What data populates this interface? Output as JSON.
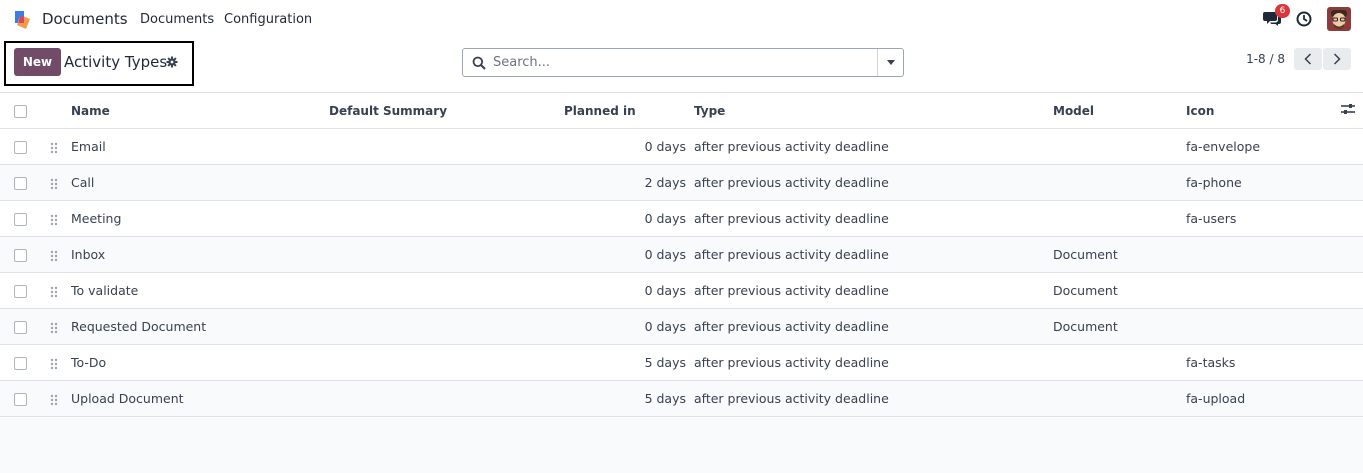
{
  "navbar": {
    "app_name": "Documents",
    "menus": [
      "Documents",
      "Configuration"
    ],
    "messages_badge": "6",
    "brand_colors": {
      "primary": "#714b67",
      "badge": "#d9363e"
    }
  },
  "control_panel": {
    "new_label": "New",
    "title": "Activity Types",
    "search_placeholder": "Search...",
    "pager_value": "1-8 / 8"
  },
  "table": {
    "headers": {
      "name": "Name",
      "summary": "Default Summary",
      "planned": "Planned in",
      "type": "Type",
      "model": "Model",
      "icon": "Icon"
    },
    "rows": [
      {
        "name": "Email",
        "summary": "",
        "planned": "0 days",
        "type": "after previous activity deadline",
        "model": "",
        "icon": "fa-envelope"
      },
      {
        "name": "Call",
        "summary": "",
        "planned": "2 days",
        "type": "after previous activity deadline",
        "model": "",
        "icon": "fa-phone"
      },
      {
        "name": "Meeting",
        "summary": "",
        "planned": "0 days",
        "type": "after previous activity deadline",
        "model": "",
        "icon": "fa-users"
      },
      {
        "name": "Inbox",
        "summary": "",
        "planned": "0 days",
        "type": "after previous activity deadline",
        "model": "Document",
        "icon": ""
      },
      {
        "name": "To validate",
        "summary": "",
        "planned": "0 days",
        "type": "after previous activity deadline",
        "model": "Document",
        "icon": ""
      },
      {
        "name": "Requested Document",
        "summary": "",
        "planned": "0 days",
        "type": "after previous activity deadline",
        "model": "Document",
        "icon": ""
      },
      {
        "name": "To-Do",
        "summary": "",
        "planned": "5 days",
        "type": "after previous activity deadline",
        "model": "",
        "icon": "fa-tasks"
      },
      {
        "name": "Upload Document",
        "summary": "",
        "planned": "5 days",
        "type": "after previous activity deadline",
        "model": "",
        "icon": "fa-upload"
      }
    ]
  }
}
